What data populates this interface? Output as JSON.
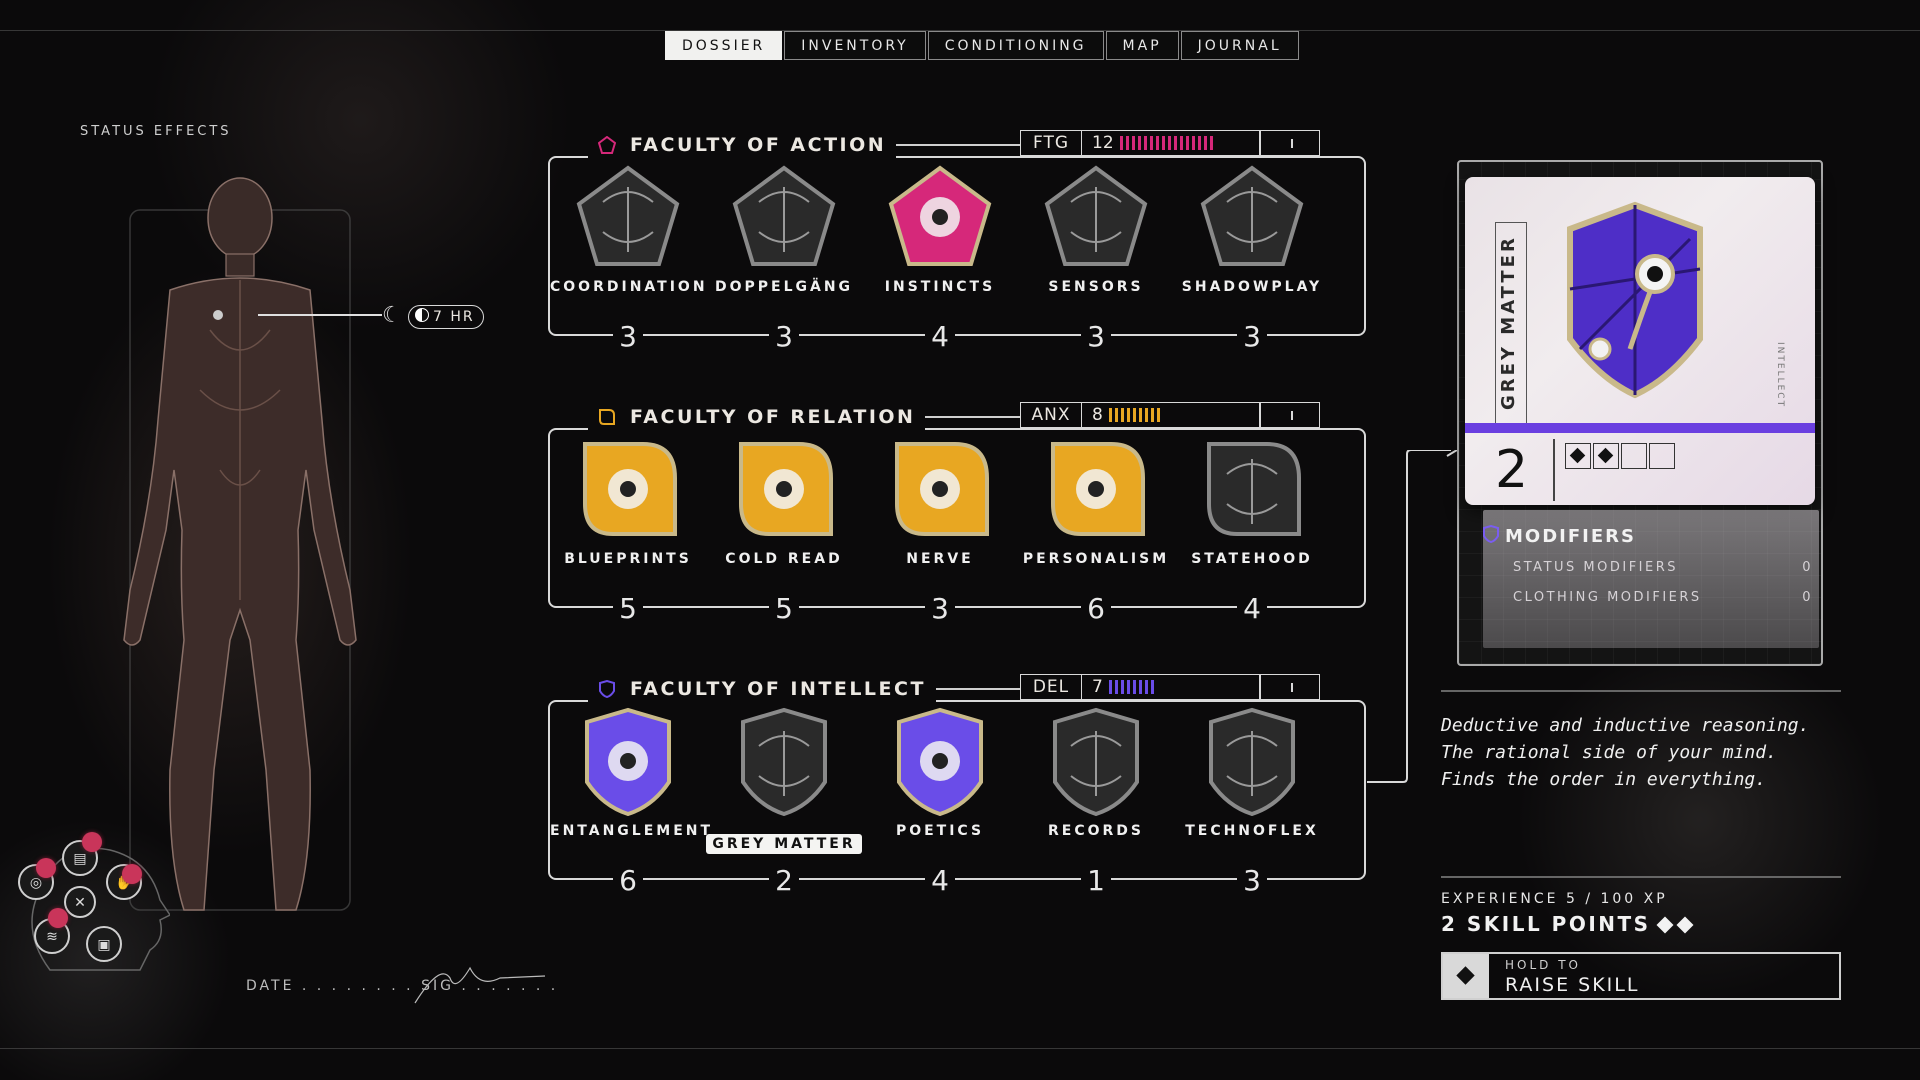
{
  "tabs": [
    "DOSSIER",
    "INVENTORY",
    "CONDITIONING",
    "MAP",
    "JOURNAL"
  ],
  "active_tab": "DOSSIER",
  "status": {
    "label": "STATUS EFFECTS",
    "time": "7 HR",
    "date_sig": "DATE . . . . . . . . SIG . . . . . . ."
  },
  "faculties": [
    {
      "title": "FACULTY OF ACTION",
      "icon": "pentagon-icon",
      "color": "#d6287a",
      "meter": {
        "code": "FTG",
        "value": "12",
        "bar_count": 16
      },
      "skills": [
        {
          "name": "COORDINATION",
          "value": "3",
          "icon": "cat-icon",
          "unlocked": false
        },
        {
          "name": "DOPPELGÄNG",
          "value": "3",
          "icon": "wolf-icon",
          "unlocked": false
        },
        {
          "name": "INSTINCTS",
          "value": "4",
          "icon": "rabbit-icon",
          "unlocked": true
        },
        {
          "name": "SENSORS",
          "value": "3",
          "icon": "shell-icon",
          "unlocked": false
        },
        {
          "name": "SHADOWPLAY",
          "value": "3",
          "icon": "octopus-icon",
          "unlocked": false
        }
      ]
    },
    {
      "title": "FACULTY OF RELATION",
      "icon": "rounded-square-icon",
      "color": "#e8a722",
      "meter": {
        "code": "ANX",
        "value": "8",
        "bar_count": 9
      },
      "skills": [
        {
          "name": "BLUEPRINTS",
          "value": "5",
          "icon": "dove-icon",
          "unlocked": true
        },
        {
          "name": "COLD READ",
          "value": "5",
          "icon": "mantis-icon",
          "unlocked": true
        },
        {
          "name": "NERVE",
          "value": "3",
          "icon": "snake-icon",
          "unlocked": true
        },
        {
          "name": "PERSONALISM",
          "value": "6",
          "icon": "dolphin-icon",
          "unlocked": true
        },
        {
          "name": "STATEHOOD",
          "value": "4",
          "icon": "armadillo-icon",
          "unlocked": false
        }
      ]
    },
    {
      "title": "FACULTY OF INTELLECT",
      "icon": "shield-icon",
      "color": "#6a4de8",
      "meter": {
        "code": "DEL",
        "value": "7",
        "bar_count": 8
      },
      "skills": [
        {
          "name": "ENTANGLEMENT",
          "value": "6",
          "icon": "fish-icon",
          "unlocked": true
        },
        {
          "name": "GREY MATTER",
          "value": "2",
          "icon": "spider-icon",
          "unlocked": false,
          "selected": true
        },
        {
          "name": "POETICS",
          "value": "4",
          "icon": "moth-icon",
          "unlocked": true
        },
        {
          "name": "RECORDS",
          "value": "1",
          "icon": "crow-icon",
          "unlocked": false
        },
        {
          "name": "TECHNOFLEX",
          "value": "3",
          "icon": "gears-icon",
          "unlocked": false
        }
      ]
    }
  ],
  "card": {
    "title": "GREY MATTER",
    "level": "2",
    "pips_filled": 2,
    "pips_total": 4,
    "side_text": "INTELLECT",
    "modifiers_title": "MODIFIERS",
    "modifiers": [
      {
        "label": "STATUS MODIFIERS",
        "value": "0"
      },
      {
        "label": "CLOTHING MODIFIERS",
        "value": "0"
      }
    ]
  },
  "description": "Deductive and inductive reasoning. The rational side of your mind. Finds the order in everything.",
  "experience": "EXPERIENCE 5 / 100 XP",
  "skill_points": "2 SKILL POINTS",
  "raise": {
    "line1": "HOLD TO",
    "line2": "RAISE SKILL"
  }
}
